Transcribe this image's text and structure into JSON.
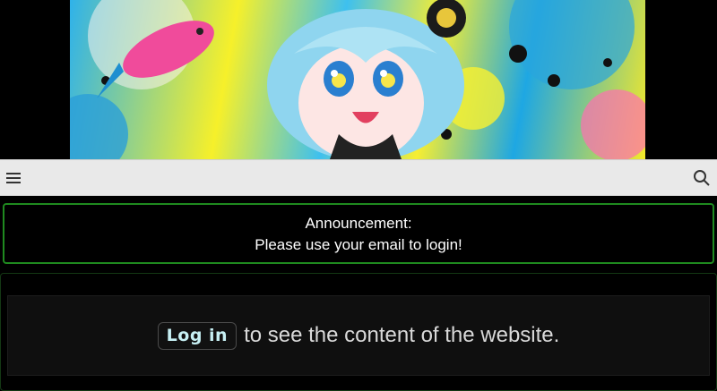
{
  "banner": {
    "image_alt": "anime girl with fish illustration"
  },
  "navbar": {
    "menu_icon": "hamburger-menu-icon",
    "search_icon": "search-icon"
  },
  "announcement": {
    "title": "Announcement:",
    "message": "Please use your email to login!"
  },
  "content": {
    "login_label": "Log in",
    "message": "to see the content of the website."
  },
  "colors": {
    "navbar_bg": "#e9e9e9",
    "announcement_border": "#1f8a1f",
    "login_text": "#c7f0f4"
  }
}
